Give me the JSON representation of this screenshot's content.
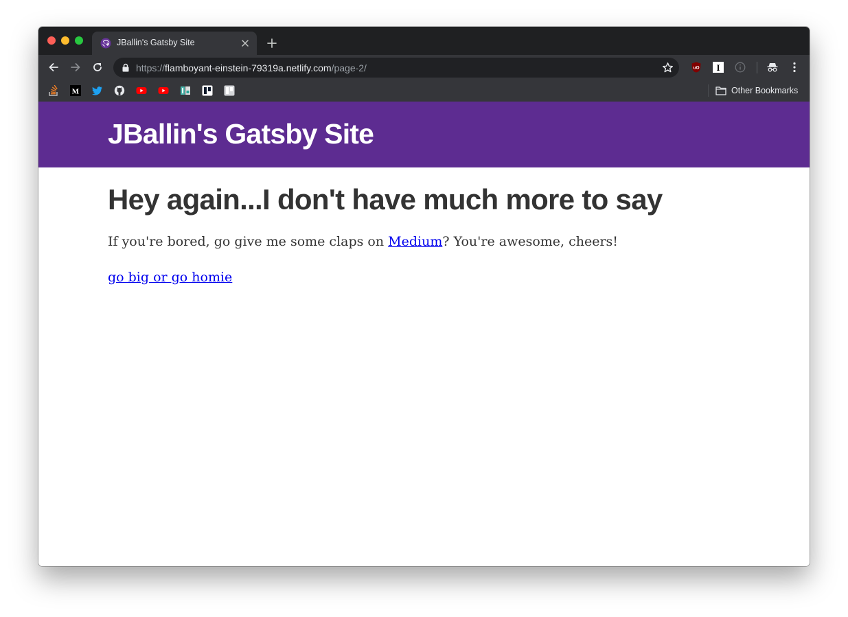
{
  "browser": {
    "tab": {
      "title": "JBallin's Gatsby Site",
      "favicon": "gatsby-icon"
    },
    "address": {
      "scheme": "https://",
      "host": "flamboyant-einstein-79319a.netlify.com",
      "path": "/page-2/"
    },
    "bookmarks": {
      "items": [
        {
          "icon": "stack-overflow-icon"
        },
        {
          "icon": "medium-icon"
        },
        {
          "icon": "twitter-icon"
        },
        {
          "icon": "github-icon"
        },
        {
          "icon": "youtube-icon"
        },
        {
          "icon": "youtube-icon"
        },
        {
          "icon": "bookmark-app-icon"
        },
        {
          "icon": "trello-icon"
        },
        {
          "icon": "trello-icon"
        }
      ],
      "other_label": "Other Bookmarks"
    },
    "colors": {
      "tabstrip": "#1f2022",
      "toolbar": "#35363a",
      "omnibox": "#202124"
    }
  },
  "site": {
    "header_title": "JBallin's Gatsby Site",
    "header_color": "#5d2c91",
    "heading": "Hey again...I don't have much more to say",
    "paragraph": {
      "before": "If you're bored, go give me some claps on ",
      "link": "Medium",
      "after": "? You're awesome, cheers!"
    },
    "home_link": "go big or go homie",
    "link_color": "#0000ee"
  }
}
